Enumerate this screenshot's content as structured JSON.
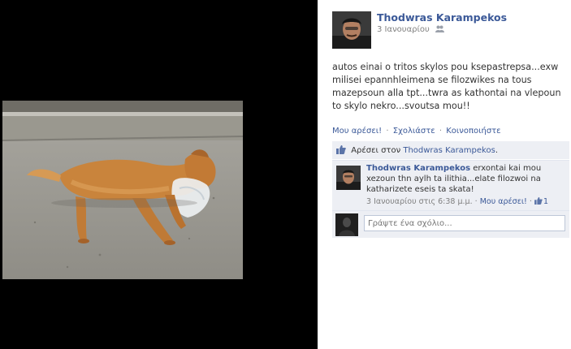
{
  "post": {
    "author": "Thodwras Karampekos",
    "date": "3 Ιανουαρίου",
    "privacy_icon": "people-icon",
    "caption": "autos einai o tritos skylos pou ksepastrepsa...exw milisei epannhleimena se filozwikes na tous mazepsoun alla tpt...twra as kathontai na vlepoun to skylo nekro...svoutsa mou!!"
  },
  "actions": {
    "like": "Μου αρέσει!",
    "sep": "·",
    "comment": "Σχολιάστε",
    "share": "Κοινοποιήστε"
  },
  "likes": {
    "prefix": "Αρέσει στον",
    "name": "Thodwras Karampekos",
    "suffix": "."
  },
  "comment": {
    "author": "Thodwras Karampekos",
    "text": " erxontai kai mou xezoun thn aylh ta ilithia...elate filozwoi na katharizete eseis ta skata!",
    "time": "3 Ιανουαρίου στις 6:38 μ.μ.",
    "sep": "·",
    "like": "Μου αρέσει!",
    "like_count": "1"
  },
  "composer": {
    "placeholder": "Γράψτε ένα σχόλιο..."
  },
  "colors": {
    "link": "#3b5998",
    "panel": "#edeff4",
    "stage": "#000000"
  }
}
